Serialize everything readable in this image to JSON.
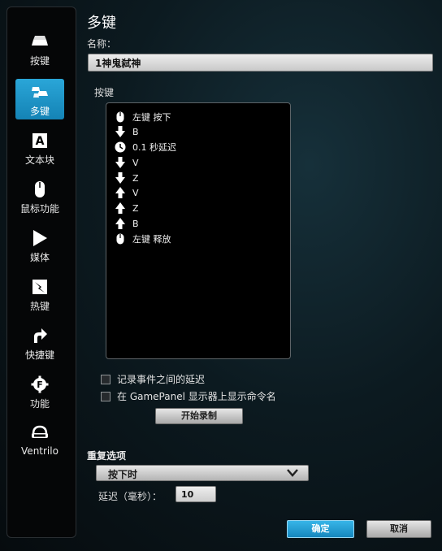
{
  "sidebar": {
    "items": [
      {
        "label": "按键",
        "icon": "keycap-icon"
      },
      {
        "label": "多键",
        "icon": "multi-key-icon",
        "active": true
      },
      {
        "label": "文本块",
        "icon": "text-block-icon"
      },
      {
        "label": "鼠标功能",
        "icon": "mouse-icon"
      },
      {
        "label": "媒体",
        "icon": "play-icon"
      },
      {
        "label": "热键",
        "icon": "hotkey-icon"
      },
      {
        "label": "快捷键",
        "icon": "shortcut-arrow-icon"
      },
      {
        "label": "功能",
        "icon": "function-gear-icon"
      },
      {
        "label": "Ventrilo",
        "icon": "headset-icon"
      }
    ]
  },
  "main": {
    "title": "多键",
    "name_label": "名称：",
    "name_value": "1神鬼弑神",
    "keys_label": "按键",
    "keys": [
      {
        "icon": "mouse-icon",
        "text": "左键 按下"
      },
      {
        "icon": "arrow-down-icon",
        "text": "B"
      },
      {
        "icon": "clock-icon",
        "text": "0.1 秒延迟"
      },
      {
        "icon": "arrow-down-icon",
        "text": "V"
      },
      {
        "icon": "arrow-down-icon",
        "text": "Z"
      },
      {
        "icon": "arrow-up-icon",
        "text": "V"
      },
      {
        "icon": "arrow-up-icon",
        "text": "Z"
      },
      {
        "icon": "arrow-up-icon",
        "text": "B"
      },
      {
        "icon": "mouse-icon",
        "text": "左键 释放"
      }
    ],
    "record_delay_label": "记录事件之间的延迟",
    "show_name_label": "在 GamePanel 显示器上显示命令名",
    "start_record_label": "开始录制",
    "repeat_label": "重复选项",
    "repeat_value": "按下时",
    "delay_label": "延迟（毫秒）：",
    "delay_value": "10",
    "ok_label": "确定",
    "cancel_label": "取消"
  },
  "colors": {
    "accent": "#1a96cc",
    "background": "#0c1a20"
  }
}
